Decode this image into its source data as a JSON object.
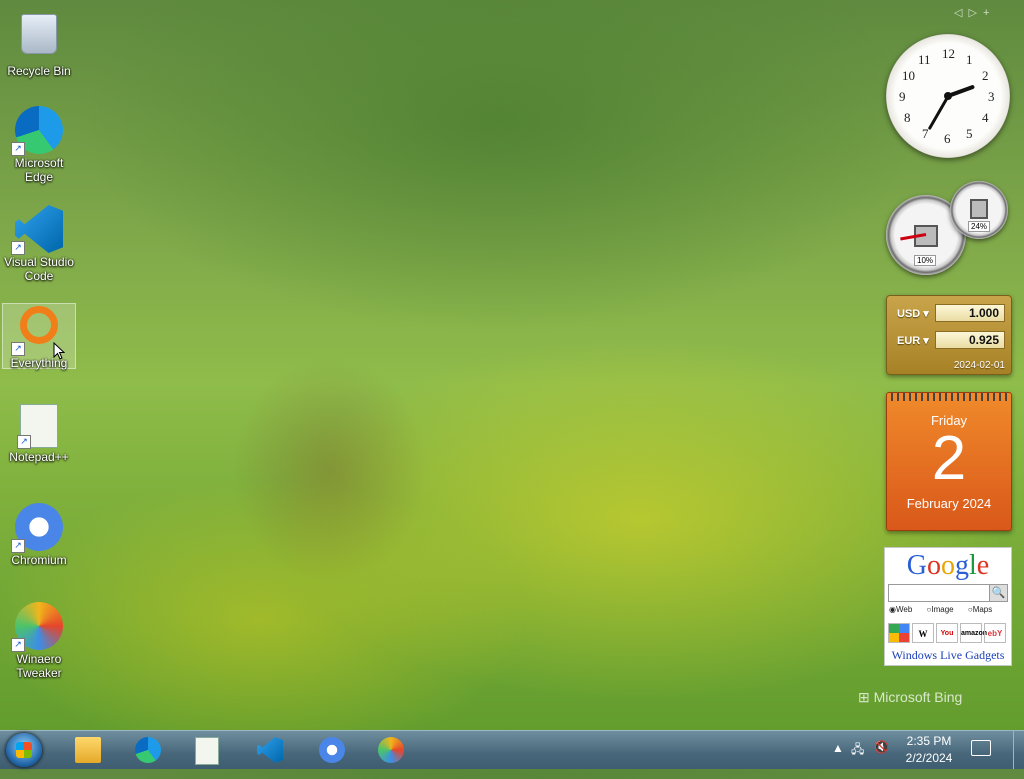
{
  "desktop_icons": [
    {
      "label": "Recycle Bin",
      "icon": "recycle-bin-icon"
    },
    {
      "label": "Microsoft Edge",
      "icon": "edge-icon"
    },
    {
      "label": "Visual Studio Code",
      "icon": "vscode-icon"
    },
    {
      "label": "Everything",
      "icon": "everything-icon"
    },
    {
      "label": "Notepad++",
      "icon": "notepad-plus-plus-icon"
    },
    {
      "label": "Chromium",
      "icon": "chromium-icon"
    },
    {
      "label": "Winaero Tweaker",
      "icon": "winaero-tweaker-icon"
    }
  ],
  "clock_gadget": {
    "numbers": [
      "12",
      "1",
      "2",
      "3",
      "4",
      "5",
      "6",
      "7",
      "8",
      "9",
      "10",
      "11"
    ],
    "time": "2:35"
  },
  "cpu_meter": {
    "cpu_percent": "10%",
    "ram_percent": "24%"
  },
  "currency": {
    "from_code": "USD",
    "from_value": "1.000",
    "to_code": "EUR",
    "to_value": "0.925",
    "date": "2024-02-01"
  },
  "calendar": {
    "day_name": "Friday",
    "date": "2",
    "month_year": "February 2024"
  },
  "google_gadget": {
    "logo": "Google",
    "radio_web": "Web",
    "radio_image": "Image",
    "radio_maps": "Maps",
    "links": [
      "W",
      "You",
      "amazon",
      "ebY"
    ],
    "footer": "Windows Live Gadgets"
  },
  "watermark": "Microsoft Bing",
  "taskbar": {
    "pinned": [
      "file-explorer-icon",
      "edge-icon",
      "notepad-plus-plus-icon",
      "vscode-icon",
      "chromium-icon",
      "winaero-tweaker-icon"
    ],
    "time": "2:35 PM",
    "date": "2/2/2024"
  }
}
